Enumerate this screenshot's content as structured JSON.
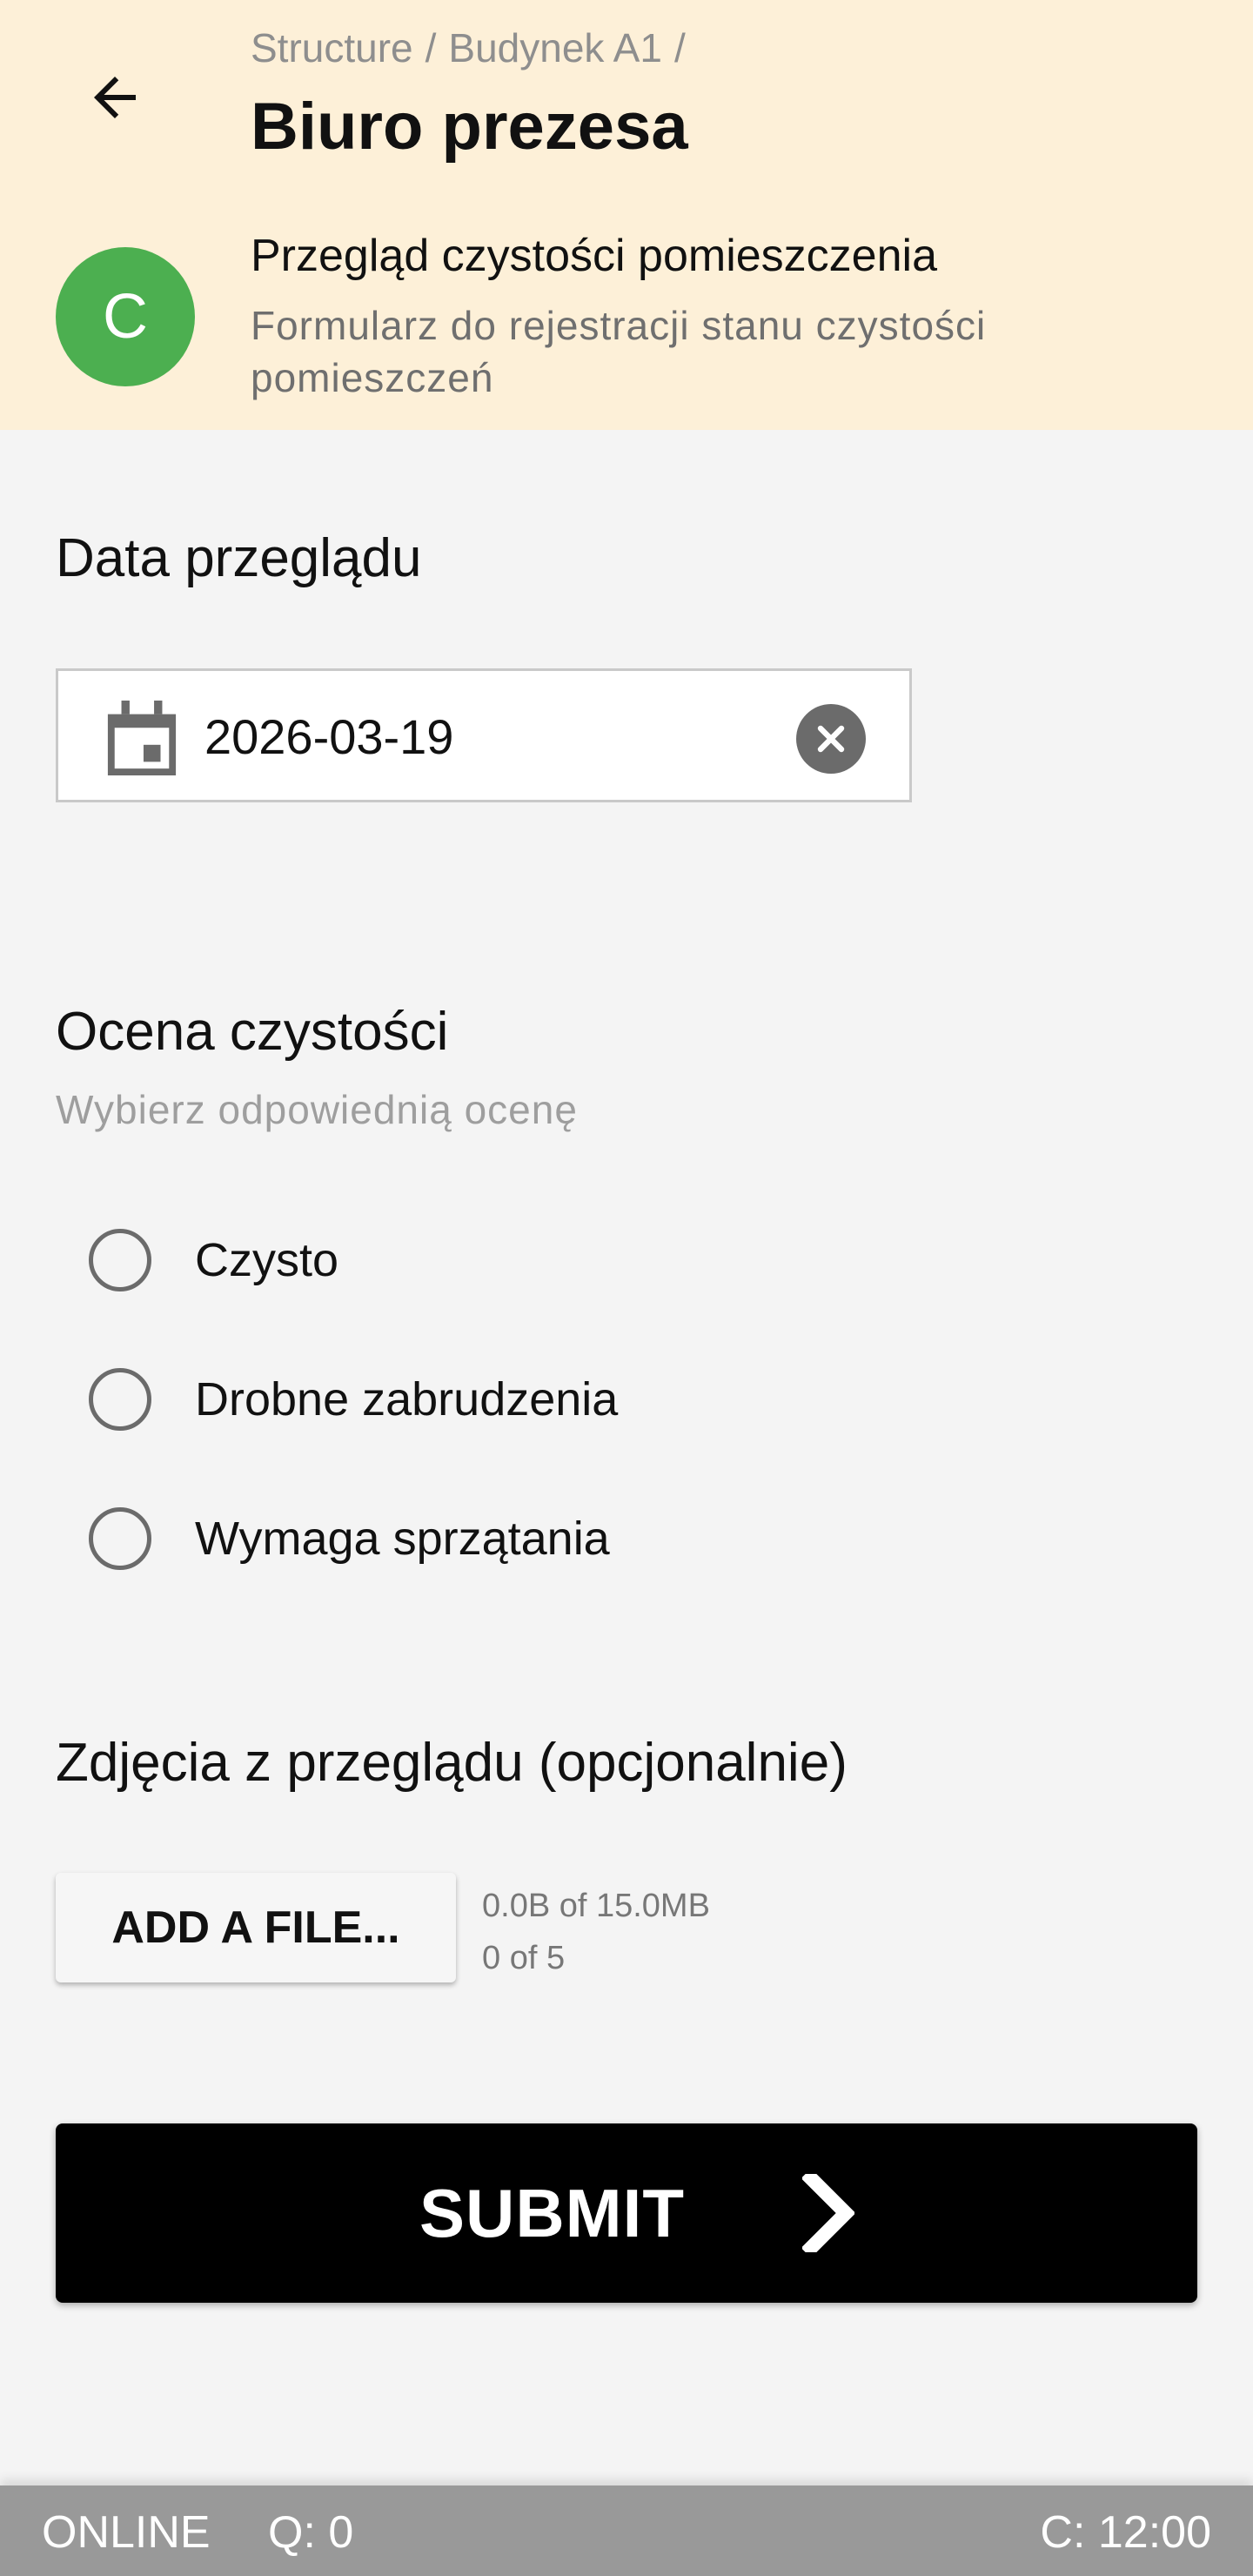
{
  "header": {
    "breadcrumb": [
      "Structure",
      "Budynek A1"
    ],
    "breadcrumb_separator": "/",
    "title": "Biuro prezesa",
    "avatar_letter": "C",
    "form_title": "Przegląd czystości pomieszczenia",
    "form_description": "Formularz do rejestracji stanu czystości pomieszczeń",
    "icons": {
      "back": "arrow-left-icon"
    }
  },
  "date_section": {
    "label": "Data przeglądu",
    "value": "2026-03-19",
    "icons": {
      "calendar": "calendar-icon",
      "clear": "clear-circle-icon"
    }
  },
  "rating_section": {
    "label": "Ocena czystości",
    "hint": "Wybierz odpowiednią ocenę",
    "options": [
      "Czysto",
      "Drobne zabrudzenia",
      "Wymaga sprzątania"
    ],
    "selected": null
  },
  "photos_section": {
    "label": "Zdjęcia z przeglądu (opcjonalnie)",
    "button_label": "ADD A FILE...",
    "size_info": "0.0B of 15.0MB",
    "count_info": "0 of 5"
  },
  "submit": {
    "label": "SUBMIT",
    "icon": "chevron-right-icon"
  },
  "status_bar": {
    "connection": "ONLINE",
    "queue": "Q: 0",
    "clock": "C: 12:00"
  },
  "colors": {
    "header_bg": "#fdf0d8",
    "avatar_bg": "#4caf50",
    "page_bg": "#f4f4f4",
    "submit_bg": "#000000",
    "status_bar_bg": "#999999"
  }
}
